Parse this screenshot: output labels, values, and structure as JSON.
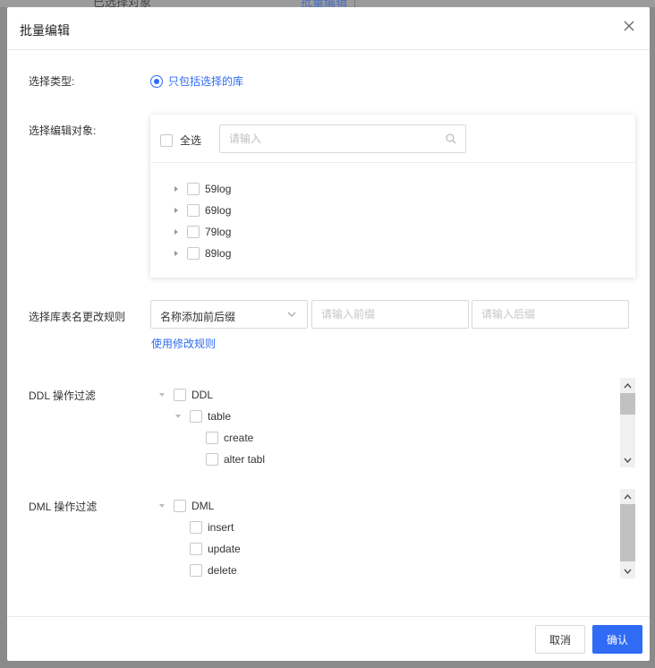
{
  "background": {
    "left_text": "已选择对象",
    "right_link": "批量编辑"
  },
  "modal": {
    "title": "批量编辑"
  },
  "select_type": {
    "label": "选择类型:",
    "option": "只包括选择的库"
  },
  "edit_objects": {
    "label": "选择编辑对象:",
    "select_all": "全选",
    "search_placeholder": "请输入",
    "items": [
      "59log",
      "69log",
      "79log",
      "89log"
    ]
  },
  "rename_rule": {
    "label": "选择库表名更改规则",
    "select_value": "名称添加前后缀",
    "prefix_placeholder": "请输入前缀",
    "suffix_placeholder": "请输入后缀",
    "link": "使用修改规则"
  },
  "ddl_filter": {
    "label": "DDL 操作过滤",
    "root": "DDL",
    "child": "table",
    "leaves": [
      "create",
      "alter tabl"
    ]
  },
  "dml_filter": {
    "label": "DML 操作过滤",
    "root": "DML",
    "leaves": [
      "insert",
      "update",
      "delete"
    ]
  },
  "footer": {
    "cancel": "取消",
    "confirm": "确认"
  },
  "colors": {
    "accent": "#2f6bf5",
    "border": "#d9d9d9",
    "overlay": "#7f7f7f"
  }
}
